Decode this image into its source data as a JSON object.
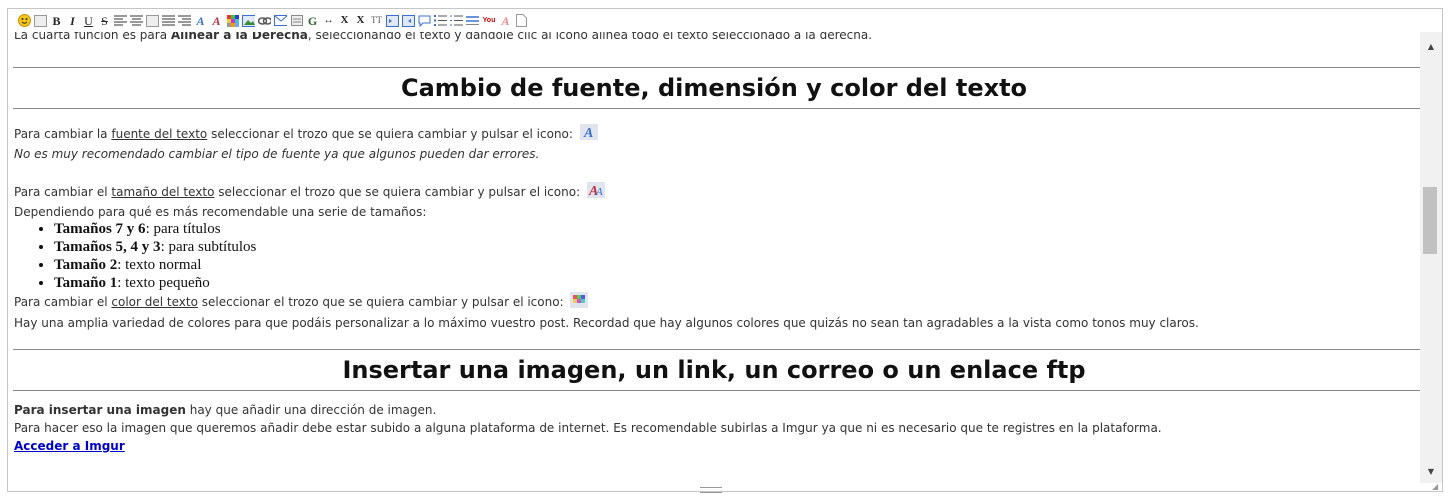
{
  "toolbar": {
    "buttons": [
      "smiley",
      "bold",
      "italic",
      "underline",
      "strikethrough",
      "align-left",
      "align-center",
      "align-justify",
      "align-right",
      "font",
      "font-size",
      "color",
      "image",
      "link",
      "email",
      "quote",
      "spoiler",
      "youtube-box",
      "ltr-rtl",
      "subscript",
      "superscript",
      "text-size",
      "indent",
      "outdent",
      "comment",
      "unordered-list",
      "ordered-list",
      "horizontal-rule",
      "youtube",
      "remove-format",
      "document"
    ],
    "bold_label": "B",
    "italic_label": "I",
    "underline_label": "U",
    "strike_label": "S",
    "font_label": "A",
    "sub_label": "X",
    "sup_label": "X",
    "youtube_label": "You"
  },
  "content": {
    "p1_pre": "La cuarta función es para ",
    "p1_bold": "Alinear a la Derecha",
    "p1_post": ", seleccionando el texto y dándole clic al icono alinea todo el texto seleccionado a la derecha.",
    "h1": "Cambio de fuente, dimensión y color del texto",
    "p2_pre": "Para cambiar la ",
    "p2_u": "fuente del texto",
    "p2_post": " seleccionar el trozo que se quiera cambiar y pulsar el icono:",
    "p3": "No es muy recomendado cambiar el tipo de fuente ya que algunos pueden dar errores.",
    "p4_pre": "Para cambiar el ",
    "p4_u": "tamaño del texto",
    "p4_post": " seleccionar el trozo que se quiera cambiar y pulsar el icono:",
    "p5": "Dependiendo para qué es más recomendable una serie de tamaños:",
    "list": [
      {
        "bold": "Tamaños 7 y 6",
        "text": ": para títulos"
      },
      {
        "bold": "Tamaños 5, 4 y 3",
        "text": ": para subtítulos"
      },
      {
        "bold": "Tamaño 2",
        "text": ": texto normal"
      },
      {
        "bold": "Tamaño 1",
        "text": ": texto pequeño"
      }
    ],
    "p6_pre": "Para cambiar el ",
    "p6_u": "color del texto",
    "p6_post": " seleccionar el trozo que se quiera cambiar y pulsar el icono:",
    "p7": "Hay una amplia variedad de colores para que podáis personalizar a lo máximo vuestro post. Recordad que hay algunos colores que quizás no sean tan agradables a la vista como tonos muy claros.",
    "h2": "Insertar una imagen, un link, un correo o un enlace ftp",
    "p8_bold": "Para insertar una imagen",
    "p8_post": " hay que añadir una dirección de imagen.",
    "p9": "Para hacer eso la imagen que queremos añadir debe estar subido a alguna plataforma de internet. Es recomendable subirlas a Imgur ya que ni es necesario que te registres en la plataforma.",
    "link": "Acceder a Imgur"
  },
  "colors": {
    "link": "#0000cc",
    "rule": "#888888",
    "text": "#333333"
  }
}
